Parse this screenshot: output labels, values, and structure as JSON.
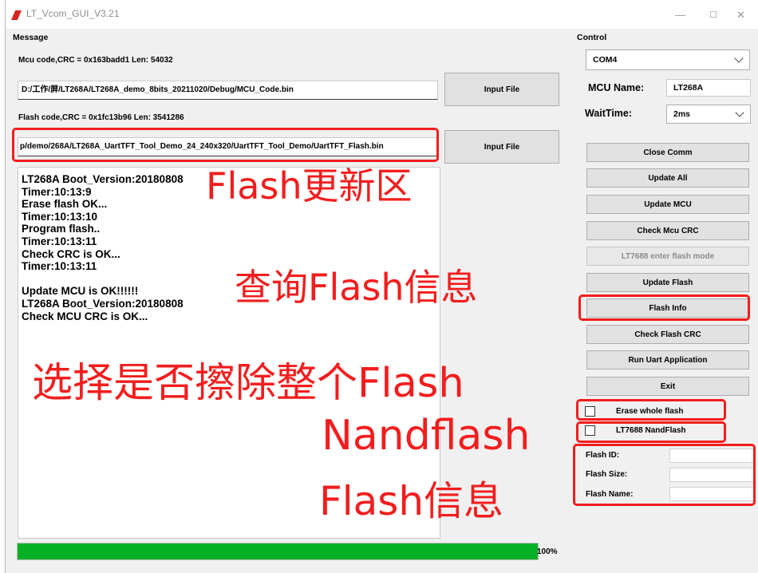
{
  "window": {
    "title": "LT_Vcom_GUI_V3.21",
    "minimize": "—",
    "maximize": "☐",
    "close": "✕"
  },
  "message": {
    "label": "Message",
    "mcu_info": "Mcu code,CRC = 0x163badd1  Len: 54032",
    "mcu_path": "D:/工作/屏/LT268A/LT268A_demo_8bits_20211020/Debug/MCU_Code.bin",
    "flash_info": "Flash code,CRC = 0x1fc13b96  Len: 3541286",
    "flash_path": "p/demo/268A/LT268A_UartTFT_Tool_Demo_24_240x320/UartTFT_Tool_Demo/UartTFT_Flash.bin",
    "input_file_label": "Input File"
  },
  "log": {
    "lines": [
      "LT268A Boot_Version:20180808",
      "Timer:10:13:9",
      "Erase flash OK...",
      "Timer:10:13:10",
      "Program flash..",
      "Timer:10:13:11",
      "Check CRC is OK...",
      "Timer:10:13:11",
      "",
      "Update MCU is OK!!!!!!",
      "LT268A Boot_Version:20180808",
      "Check MCU CRC is OK..."
    ]
  },
  "progress": {
    "value": 1.0,
    "label": "100%",
    "color": "#06b025"
  },
  "control": {
    "label": "Control",
    "port": "COM4",
    "mcu_name_label": "MCU Name:",
    "mcu_name_value": "LT268A",
    "wait_time_label": "WaitTime:",
    "wait_time_value": "2ms",
    "buttons": {
      "close_comm": "Close Comm",
      "update_all": "Update All",
      "update_mcu": "Update MCU",
      "check_mcu_crc": "Check Mcu CRC",
      "lt7688_mode": "LT7688 enter flash mode",
      "update_flash": "Update Flash",
      "flash_info": "Flash Info",
      "check_flash_crc": "Check Flash CRC",
      "run_uart": "Run Uart Application",
      "exit": "Exit"
    },
    "erase_whole_flash": "Erase whole flash",
    "nandflash": "LT7688 NandFlash",
    "flash_id_label": "Flash ID:",
    "flash_size_label": "Flash Size:",
    "flash_name_label": "Flash Name:"
  },
  "annotations": {
    "flash_update_area": "Flash更新区",
    "query_flash_info": "查询Flash信息",
    "erase_select": "选择是否擦除整个Flash",
    "nandflash": "Nandflash",
    "flash_info": "Flash信息",
    "color": "#f31d1d"
  }
}
